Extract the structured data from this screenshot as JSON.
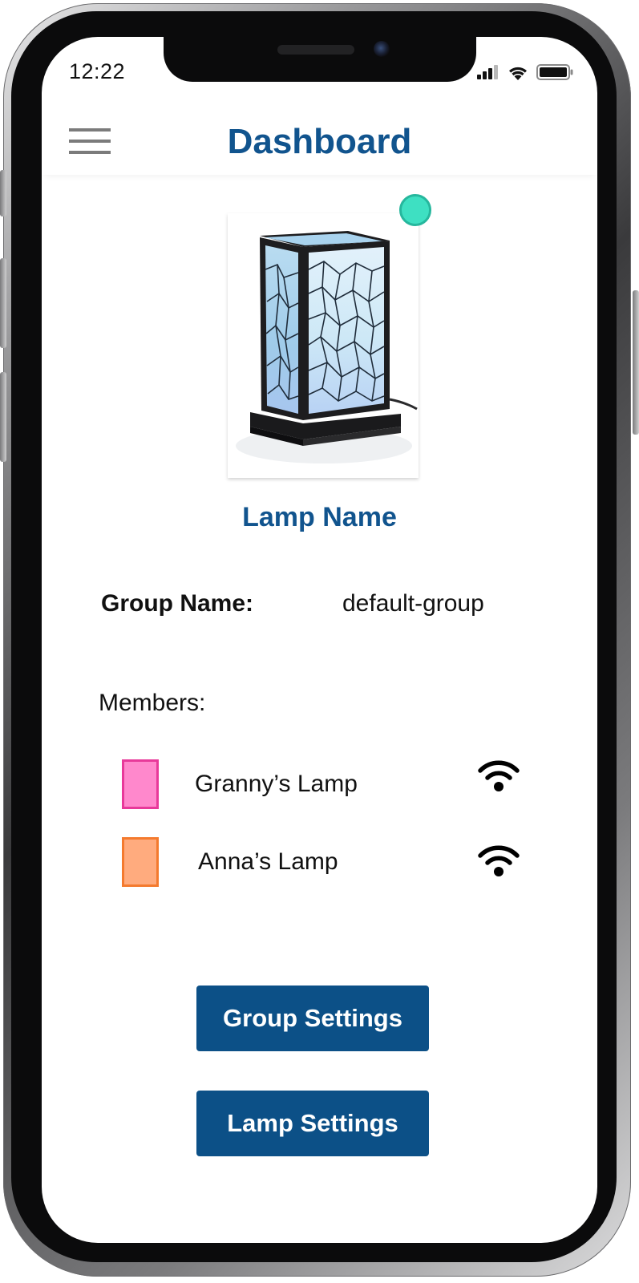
{
  "status_bar": {
    "time": "12:22",
    "icons": [
      "cellular-signal-icon",
      "wifi-icon",
      "battery-icon"
    ]
  },
  "header": {
    "title": "Dashboard",
    "menu_icon": "hamburger-menu-icon"
  },
  "lamp": {
    "name": "Lamp Name",
    "image": "table-lamp-photo",
    "status_color": "#3ee0c2"
  },
  "group": {
    "label": "Group Name:",
    "value": "default-group"
  },
  "members": {
    "label": "Members:",
    "items": [
      {
        "name": "Granny’s Lamp",
        "color": "#ff88cc",
        "border_color": "#e8399a",
        "signal_icon": "wifi-icon"
      },
      {
        "name": "Anna’s Lamp",
        "color": "#ffab7e",
        "border_color": "#f47a2e",
        "signal_icon": "wifi-icon"
      }
    ]
  },
  "buttons": {
    "group_settings": "Group Settings",
    "lamp_settings": "Lamp Settings"
  },
  "colors": {
    "brand_blue": "#11548e",
    "button_blue": "#0c5087"
  }
}
